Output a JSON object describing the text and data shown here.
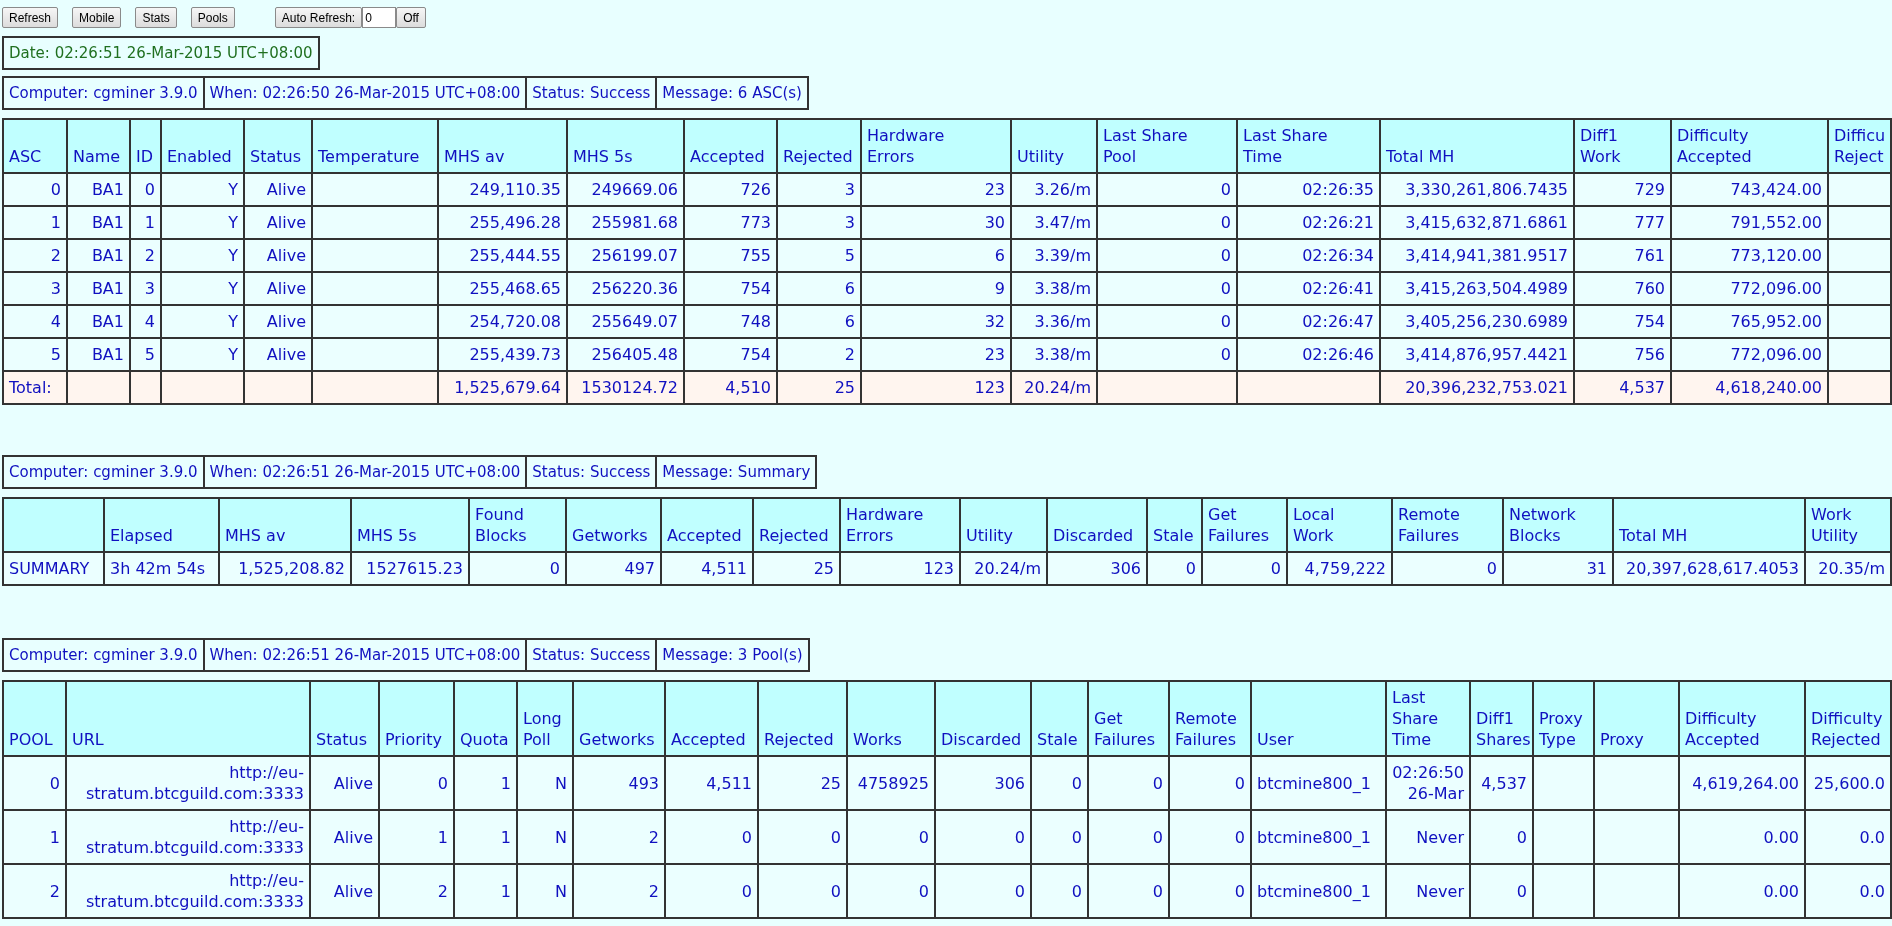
{
  "toolbar": {
    "buttons": [
      "Refresh",
      "Mobile",
      "Stats",
      "Pools"
    ],
    "auto_refresh": {
      "label": "Auto Refresh:",
      "value": "0",
      "toggle": "Off"
    }
  },
  "date": "Date: 02:26:51 26-Mar-2015 UTC+08:00",
  "sections": [
    {
      "kind": "asc",
      "info": [
        "Computer: cgminer 3.9.0",
        "When: 02:26:50 26-Mar-2015 UTC+08:00",
        "Status: Success",
        "Message: 6 ASC(s)"
      ],
      "columns": [
        {
          "label": "ASC",
          "kind": "number"
        },
        {
          "label": "Name",
          "kind": "number"
        },
        {
          "label": "ID",
          "kind": "number"
        },
        {
          "label": "Enabled",
          "kind": "number"
        },
        {
          "label": "Status",
          "kind": "number"
        },
        {
          "label": "Temperature",
          "kind": "number"
        },
        {
          "label": "MHS av",
          "kind": "number"
        },
        {
          "label": "MHS 5s",
          "kind": "number"
        },
        {
          "label": "Accepted",
          "kind": "number"
        },
        {
          "label": "Rejected",
          "kind": "number"
        },
        {
          "label": "Hardware\nErrors",
          "kind": "number"
        },
        {
          "label": "Utility",
          "kind": "number"
        },
        {
          "label": "Last Share\nPool",
          "kind": "number"
        },
        {
          "label": "Last Share\nTime",
          "kind": "number"
        },
        {
          "label": "Total MH",
          "kind": "number"
        },
        {
          "label": "Diff1\nWork",
          "kind": "number"
        },
        {
          "label": "Difficulty\nAccepted",
          "kind": "number"
        },
        {
          "label": "Difficu\nReject",
          "kind": "number"
        }
      ],
      "rows": [
        {
          "asc": "0",
          "name": "BA1",
          "id": "0",
          "enabled": "Y",
          "status": "Alive",
          "mhs_av": "249,110.35",
          "mhs_5s": "249669.06",
          "accepted": "726",
          "rejected": "3",
          "hw": "23",
          "utility": "3.26/m",
          "ls_pool": "0",
          "ls_time": "02:26:35",
          "total_mh": "3,330,261,806.7435",
          "diff1": "729",
          "diff_acc": "743,424.00"
        },
        {
          "asc": "1",
          "name": "BA1",
          "id": "1",
          "enabled": "Y",
          "status": "Alive",
          "mhs_av": "255,496.28",
          "mhs_5s": "255981.68",
          "accepted": "773",
          "rejected": "3",
          "hw": "30",
          "utility": "3.47/m",
          "ls_pool": "0",
          "ls_time": "02:26:21",
          "total_mh": "3,415,632,871.6861",
          "diff1": "777",
          "diff_acc": "791,552.00"
        },
        {
          "asc": "2",
          "name": "BA1",
          "id": "2",
          "enabled": "Y",
          "status": "Alive",
          "mhs_av": "255,444.55",
          "mhs_5s": "256199.07",
          "accepted": "755",
          "rejected": "5",
          "hw": "6",
          "utility": "3.39/m",
          "ls_pool": "0",
          "ls_time": "02:26:34",
          "total_mh": "3,414,941,381.9517",
          "diff1": "761",
          "diff_acc": "773,120.00"
        },
        {
          "asc": "3",
          "name": "BA1",
          "id": "3",
          "enabled": "Y",
          "status": "Alive",
          "mhs_av": "255,468.65",
          "mhs_5s": "256220.36",
          "accepted": "754",
          "rejected": "6",
          "hw": "9",
          "utility": "3.38/m",
          "ls_pool": "0",
          "ls_time": "02:26:41",
          "total_mh": "3,415,263,504.4989",
          "diff1": "760",
          "diff_acc": "772,096.00"
        },
        {
          "asc": "4",
          "name": "BA1",
          "id": "4",
          "enabled": "Y",
          "status": "Alive",
          "mhs_av": "254,720.08",
          "mhs_5s": "255649.07",
          "accepted": "748",
          "rejected": "6",
          "hw": "32",
          "utility": "3.36/m",
          "ls_pool": "0",
          "ls_time": "02:26:47",
          "total_mh": "3,405,256,230.6989",
          "diff1": "754",
          "diff_acc": "765,952.00"
        },
        {
          "asc": "5",
          "name": "BA1",
          "id": "5",
          "enabled": "Y",
          "status": "Alive",
          "mhs_av": "255,439.73",
          "mhs_5s": "256405.48",
          "accepted": "754",
          "rejected": "2",
          "hw": "23",
          "utility": "3.38/m",
          "ls_pool": "0",
          "ls_time": "02:26:46",
          "total_mh": "3,414,876,957.4421",
          "diff1": "756",
          "diff_acc": "772,096.00"
        }
      ],
      "total": {
        "asc": "Total:",
        "mhs_av": "1,525,679.64",
        "mhs_5s": "1530124.72",
        "accepted": "4,510",
        "rejected": "25",
        "hw": "123",
        "utility": "20.24/m",
        "total_mh": "20,396,232,753.021",
        "diff1": "4,537",
        "diff_acc": "4,618,240.00"
      }
    },
    {
      "kind": "summary",
      "info": [
        "Computer: cgminer 3.9.0",
        "When: 02:26:51 26-Mar-2015 UTC+08:00",
        "Status: Success",
        "Message: Summary"
      ],
      "columns": [
        {
          "kind": "text"
        },
        {
          "label": "Elapsed",
          "kind": "text"
        },
        {
          "label": "MHS av",
          "kind": "number"
        },
        {
          "label": "MHS 5s",
          "kind": "number"
        },
        {
          "label": "Found\nBlocks",
          "kind": "number"
        },
        {
          "label": "Getworks",
          "kind": "number"
        },
        {
          "label": "Accepted",
          "kind": "number"
        },
        {
          "label": "Rejected",
          "kind": "number"
        },
        {
          "label": "Hardware\nErrors",
          "kind": "number"
        },
        {
          "label": "Utility",
          "kind": "number"
        },
        {
          "label": "Discarded",
          "kind": "number"
        },
        {
          "label": "Stale",
          "kind": "number"
        },
        {
          "label": "Get\nFailures",
          "kind": "number"
        },
        {
          "label": "Local\nWork",
          "kind": "number"
        },
        {
          "label": "Remote\nFailures",
          "kind": "number"
        },
        {
          "label": "Network\nBlocks",
          "kind": "number"
        },
        {
          "label": "Total MH",
          "kind": "number"
        },
        {
          "label": "Work\nUtility",
          "kind": "number"
        }
      ],
      "rows": [
        {
          "column_1": "SUMMARY",
          "elapsed": "3h 42m 54s",
          "mhs_av": "1,525,208.82",
          "mhs_5s": "1527615.23",
          "found": "0",
          "getworks": "497",
          "accepted": "4,511",
          "rejected": "25",
          "hw": "123",
          "utility": "20.24/m",
          "discarded": "306",
          "stale": "0",
          "get_fail": "0",
          "local_work": "4,759,222",
          "remote_fail": "0",
          "net_blocks": "31",
          "total_mh": "20,397,628,617.4053",
          "work_util": "20.35/m"
        }
      ]
    },
    {
      "kind": "pools",
      "info": [
        "Computer: cgminer 3.9.0",
        "When: 02:26:51 26-Mar-2015 UTC+08:00",
        "Status: Success",
        "Message: 3 Pool(s)"
      ],
      "columns": [
        {
          "label": "POOL",
          "kind": "number"
        },
        {
          "label": "URL",
          "kind": "number"
        },
        {
          "label": "Status",
          "kind": "number"
        },
        {
          "label": "Priority",
          "kind": "number"
        },
        {
          "label": "Quota",
          "kind": "number"
        },
        {
          "label": "Long\nPoll",
          "kind": "number"
        },
        {
          "label": "Getworks",
          "kind": "number"
        },
        {
          "label": "Accepted",
          "kind": "number"
        },
        {
          "label": "Rejected",
          "kind": "number"
        },
        {
          "label": "Works",
          "kind": "number"
        },
        {
          "label": "Discarded",
          "kind": "number"
        },
        {
          "label": "Stale",
          "kind": "number"
        },
        {
          "label": "Get\nFailures",
          "kind": "number"
        },
        {
          "label": "Remote\nFailures",
          "kind": "number"
        },
        {
          "label": "User",
          "kind": "text"
        },
        {
          "label": "Last\nShare\nTime",
          "kind": "number"
        },
        {
          "label": "Diff1\nShares",
          "kind": "number"
        },
        {
          "label": "Proxy\nType",
          "kind": "number"
        },
        {
          "label": "Proxy",
          "kind": "number"
        },
        {
          "label": "Difficulty\nAccepted",
          "kind": "number"
        },
        {
          "label": "Difficulty\nRejected",
          "kind": "number"
        }
      ],
      "rows": [
        {
          "pool": "0",
          "url": "http://eu-stratum.btcguild.com:3333",
          "status": "Alive",
          "priority": "0",
          "quota": "1",
          "long_poll": "N",
          "getworks": "493",
          "accepted": "4,511",
          "rejected": "25",
          "works": "4758925",
          "discarded": "306",
          "stale": "0",
          "get_fail": "0",
          "remote_fail": "0",
          "user": "btcmine800_1",
          "ls_time": "02:26:50 26-Mar",
          "diff1": "4,537",
          "diff_acc": "4,619,264.00",
          "diff_rej": "25,600.0"
        },
        {
          "pool": "1",
          "url": "http://eu-stratum.btcguild.com:3333",
          "status": "Alive",
          "priority": "1",
          "quota": "1",
          "long_poll": "N",
          "getworks": "2",
          "accepted": "0",
          "rejected": "0",
          "works": "0",
          "discarded": "0",
          "stale": "0",
          "get_fail": "0",
          "remote_fail": "0",
          "user": "btcmine800_1",
          "ls_time": "Never",
          "diff1": "0",
          "diff_acc": "0.00",
          "diff_rej": "0.0"
        },
        {
          "pool": "2",
          "url": "http://eu-stratum.btcguild.com:3333",
          "status": "Alive",
          "priority": "2",
          "quota": "1",
          "long_poll": "N",
          "getworks": "2",
          "accepted": "0",
          "rejected": "0",
          "works": "0",
          "discarded": "0",
          "stale": "0",
          "get_fail": "0",
          "remote_fail": "0",
          "user": "btcmine800_1",
          "ls_time": "Never",
          "diff1": "0",
          "diff_acc": "0.00",
          "diff_rej": "0.0"
        }
      ]
    }
  ]
}
